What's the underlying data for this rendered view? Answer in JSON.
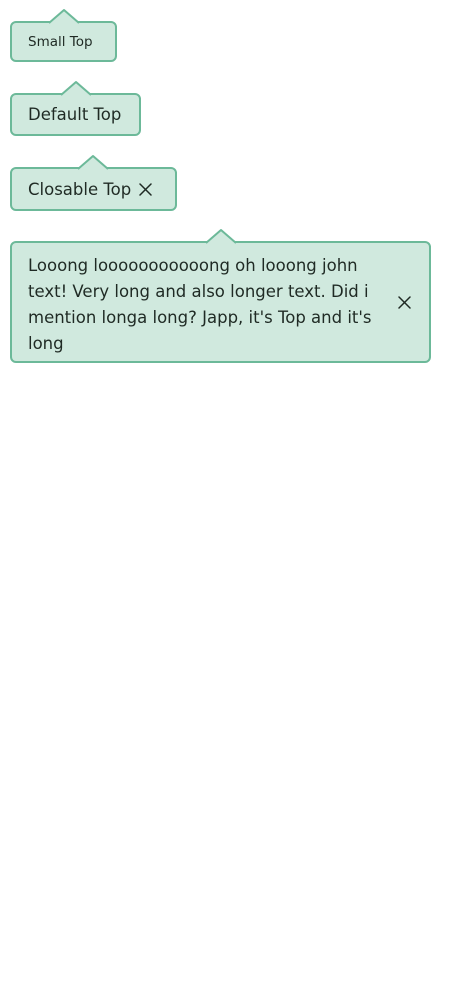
{
  "tooltips": {
    "small": {
      "label": "Small Top"
    },
    "default": {
      "label": "Default Top"
    },
    "closable": {
      "label": "Closable Top",
      "close_icon": "close-icon"
    },
    "long": {
      "text": "Looong looooooooooong oh looong john text! Very long and also longer text. Did i mention longa long? Japp, it's  Top and it's long",
      "close_icon": "close-icon"
    }
  },
  "colors": {
    "background": "#d0e9de",
    "border": "#6cb999",
    "text": "#1f2a24"
  }
}
